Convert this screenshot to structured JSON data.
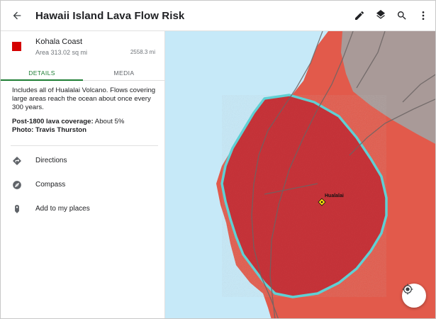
{
  "header": {
    "title": "Hawaii Island Lava Flow Risk",
    "icons": [
      "back-arrow-icon",
      "edit-pencil-icon",
      "layers-icon",
      "search-icon",
      "more-vert-icon"
    ]
  },
  "feature": {
    "name": "Kohala Coast",
    "area": "Area 313.02 sq mi",
    "distance": "2558.3 mi",
    "swatch_color": "#d40000"
  },
  "tabs": [
    {
      "label": "DETAILS",
      "active": true
    },
    {
      "label": "MEDIA",
      "active": false
    }
  ],
  "details": {
    "description": "Includes all of Hualalai Volcano. Flows covering large areas reach the ocean about once every 300 years.",
    "coverage_label": "Post-1800 lava coverage:",
    "coverage_value": " About 5%",
    "photo_label": "Photo: Travis Thurston"
  },
  "actions": [
    {
      "label": "Directions",
      "icon": "directions-icon"
    },
    {
      "label": "Compass",
      "icon": "compass-icon"
    },
    {
      "label": "Add to my places",
      "icon": "bookmark-pin-icon"
    }
  ],
  "map": {
    "volcano_label": "Hualalai",
    "colors": {
      "ocean": "#c6e9f8",
      "risk_zone": "#e25a4b",
      "selected_zone": "#c8343a",
      "outline": "#5fd0d4",
      "low_risk": "#a99a98"
    }
  }
}
